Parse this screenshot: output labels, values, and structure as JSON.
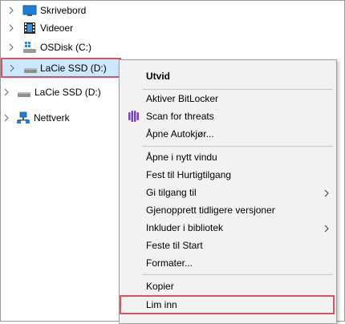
{
  "tree": {
    "items": [
      {
        "label": "Skrivebord",
        "icon": "desktop-icon"
      },
      {
        "label": "Videoer",
        "icon": "videos-icon"
      },
      {
        "label": "OSDisk (C:)",
        "icon": "os-disk-icon"
      },
      {
        "label": "LaCie SSD (D:)",
        "icon": "drive-icon",
        "selected": true
      },
      {
        "label": "LaCie SSD (D:)",
        "icon": "drive-icon"
      },
      {
        "label": "Nettverk",
        "icon": "network-icon"
      }
    ]
  },
  "context_menu": {
    "items": [
      {
        "label": "Utvid",
        "bold": true
      },
      {
        "label": "Aktiver BitLocker"
      },
      {
        "label": "Scan for threats",
        "icon": "defender-scan-icon"
      },
      {
        "label": "Åpne Autokjør..."
      },
      {
        "label": "Åpne i nytt vindu"
      },
      {
        "label": "Fest til Hurtigtilgang"
      },
      {
        "label": "Gi tilgang til",
        "submenu": true
      },
      {
        "label": "Gjenopprett tidligere versjoner"
      },
      {
        "label": "Inkluder i bibliotek",
        "submenu": true
      },
      {
        "label": "Feste til Start"
      },
      {
        "label": "Formater..."
      },
      {
        "label": "Kopier"
      },
      {
        "label": "Lim inn",
        "highlighted": true
      }
    ]
  },
  "colors": {
    "highlight_border": "#e0505f",
    "selection": "#cce8ff",
    "menu_background": "#f2f2f2"
  }
}
